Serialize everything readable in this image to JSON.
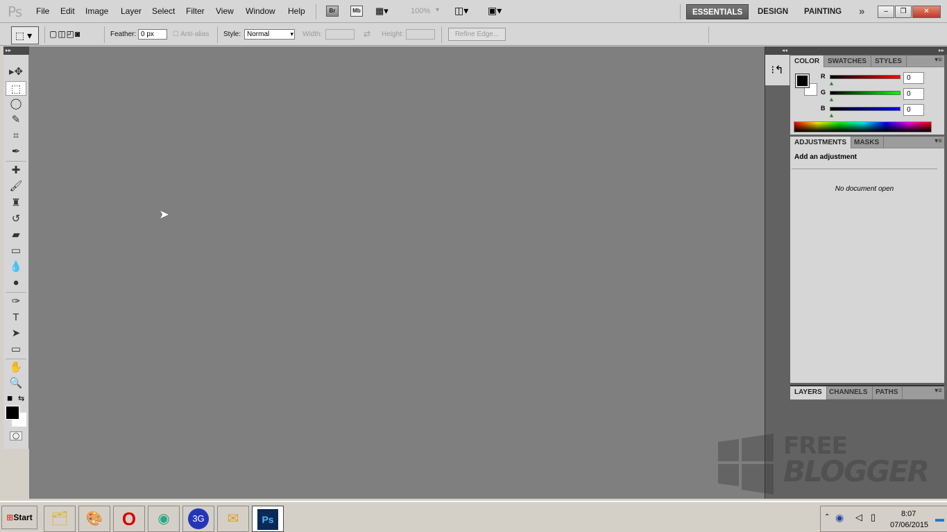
{
  "app": {
    "logo": "Ps"
  },
  "menu": [
    "File",
    "Edit",
    "Image",
    "Layer",
    "Select",
    "Filter",
    "View",
    "Window",
    "Help"
  ],
  "appbar": {
    "bridge": "Br",
    "minibridge": "Mb",
    "zoom": "100%"
  },
  "workspaces": {
    "active": "ESSENTIALS",
    "items": [
      "ESSENTIALS",
      "DESIGN",
      "PAINTING"
    ],
    "more": "»"
  },
  "window_controls": {
    "minimize": "–",
    "restore": "❐",
    "close": "✕"
  },
  "options": {
    "feather_label": "Feather:",
    "feather_value": "0 px",
    "antialias_label": "Anti-alias",
    "style_label": "Style:",
    "style_value": "Normal",
    "width_label": "Width:",
    "height_label": "Height:",
    "refine_edge": "Refine Edge..."
  },
  "tools": [
    {
      "name": "move-tool",
      "glyph": "▸✥"
    },
    {
      "name": "rectangular-marquee-tool",
      "glyph": "⬚",
      "selected": true
    },
    {
      "name": "lasso-tool",
      "glyph": "◯"
    },
    {
      "name": "quick-selection-tool",
      "glyph": "✎"
    },
    {
      "name": "crop-tool",
      "glyph": "⌗"
    },
    {
      "name": "eyedropper-tool",
      "glyph": "✒"
    },
    {
      "name": "spot-healing-brush-tool",
      "glyph": "✚"
    },
    {
      "name": "brush-tool",
      "glyph": "🖌"
    },
    {
      "name": "clone-stamp-tool",
      "glyph": "♜"
    },
    {
      "name": "history-brush-tool",
      "glyph": "↺"
    },
    {
      "name": "eraser-tool",
      "glyph": "▰"
    },
    {
      "name": "gradient-tool",
      "glyph": "▭"
    },
    {
      "name": "blur-tool",
      "glyph": "💧"
    },
    {
      "name": "dodge-tool",
      "glyph": "●"
    },
    {
      "name": "pen-tool",
      "glyph": "✑"
    },
    {
      "name": "type-tool",
      "glyph": "T"
    },
    {
      "name": "path-selection-tool",
      "glyph": "➤"
    },
    {
      "name": "rectangle-tool",
      "glyph": "▭"
    },
    {
      "name": "hand-tool",
      "glyph": "✋"
    },
    {
      "name": "zoom-tool",
      "glyph": "🔍"
    }
  ],
  "color_panel": {
    "tabs": [
      "COLOR",
      "SWATCHES",
      "STYLES"
    ],
    "active": "COLOR",
    "channels": [
      {
        "label": "R",
        "value": "0",
        "color": "#ff0000"
      },
      {
        "label": "G",
        "value": "0",
        "color": "#00ff00"
      },
      {
        "label": "B",
        "value": "0",
        "color": "#0000ff"
      }
    ],
    "foreground": "#000000",
    "background": "#ffffff"
  },
  "adjustments_panel": {
    "tabs": [
      "ADJUSTMENTS",
      "MASKS"
    ],
    "active": "ADJUSTMENTS",
    "heading": "Add an adjustment",
    "empty": "No document open"
  },
  "layers_panel": {
    "tabs": [
      "LAYERS",
      "CHANNELS",
      "PATHS"
    ],
    "active": "LAYERS"
  },
  "watermark": {
    "line1": "FREE",
    "line2": "BLOGGER"
  },
  "taskbar": {
    "start": "Start",
    "apps": [
      "file-explorer",
      "paint",
      "opera",
      "chrome",
      "3g-modem",
      "outlook",
      "photoshop"
    ],
    "active": "photoshop",
    "ps_label": "Ps",
    "clock": {
      "time": "8:07",
      "date": "07/06/2015"
    }
  }
}
